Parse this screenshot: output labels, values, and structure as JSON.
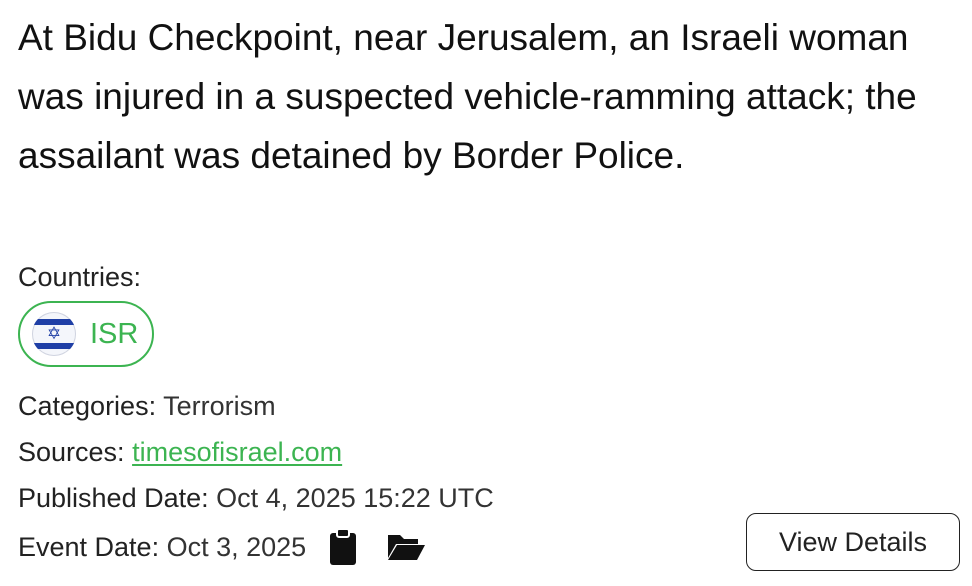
{
  "headline": "At Bidu Checkpoint, near Jerusalem, an Israeli woman was injured in a suspected vehicle-ramming attack; the assailant was detained by Border Police.",
  "countries": {
    "label": "Countries:",
    "items": [
      {
        "code": "ISR",
        "flag_icon": "israel-flag-icon"
      }
    ]
  },
  "categories": {
    "label": "Categories:",
    "value": "Terrorism"
  },
  "sources": {
    "label": "Sources:",
    "value": "timesofisrael.com"
  },
  "published": {
    "label": "Published Date:",
    "value": "Oct 4, 2025 15:22 UTC"
  },
  "event": {
    "label": "Event Date:",
    "value": "Oct 3, 2025",
    "icons": [
      "clipboard-icon",
      "folder-open-icon"
    ]
  },
  "actions": {
    "view_details_label": "View Details"
  },
  "colors": {
    "accent_green": "#3cb451",
    "flag_blue": "#1f3fa6",
    "text": "#222222"
  }
}
